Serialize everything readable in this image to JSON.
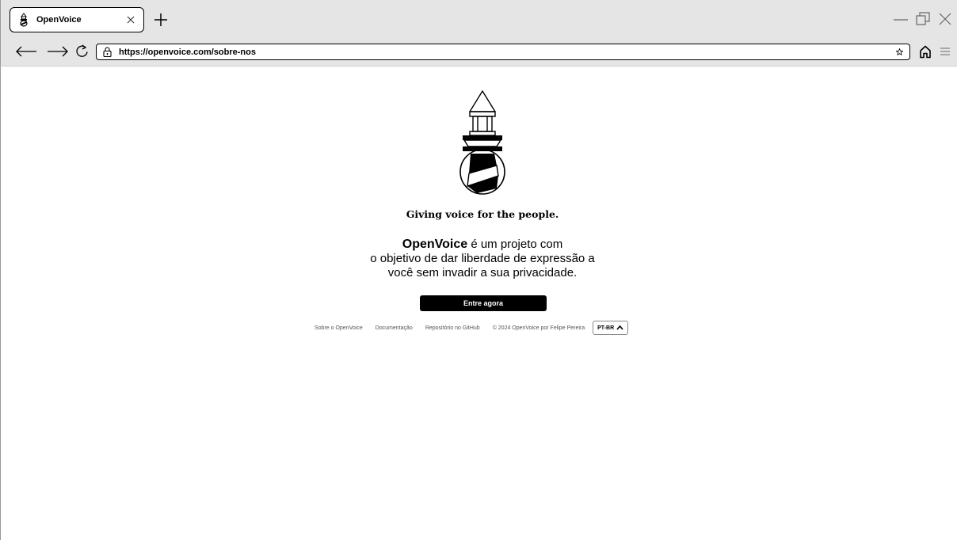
{
  "browser": {
    "tab": {
      "title": "OpenVoice"
    },
    "url": "https://openvoice.com/sobre-nos"
  },
  "page": {
    "tagline": "Giving voice for the people.",
    "description": {
      "brand": "OpenVoice",
      "line1_rest": " é um projeto com",
      "line2": "o objetivo de dar liberdade de expressão a",
      "line3": "você sem invadir a sua privacidade."
    },
    "cta_label": "Entre agora",
    "footer": {
      "links": [
        "Sobre o OpenVoice",
        "Documentação",
        "Repositório no GitHub"
      ],
      "copyright": "© 2024 OpenVoice por Felipe Pereira",
      "language": "PT-BR"
    }
  },
  "icons": {
    "favicon": "lighthouse-icon",
    "logo": "lighthouse-icon",
    "tab_close": "close-icon",
    "new_tab": "plus-icon",
    "back": "arrow-left-icon",
    "forward": "arrow-right-icon",
    "reload": "reload-icon",
    "lock": "lock-icon",
    "bookmark": "star-icon",
    "home": "home-icon",
    "menu": "hamburger-icon",
    "minimize": "minimize-icon",
    "restore": "restore-icon",
    "close_window": "close-icon",
    "language_toggle": "chevron-up-icon"
  }
}
